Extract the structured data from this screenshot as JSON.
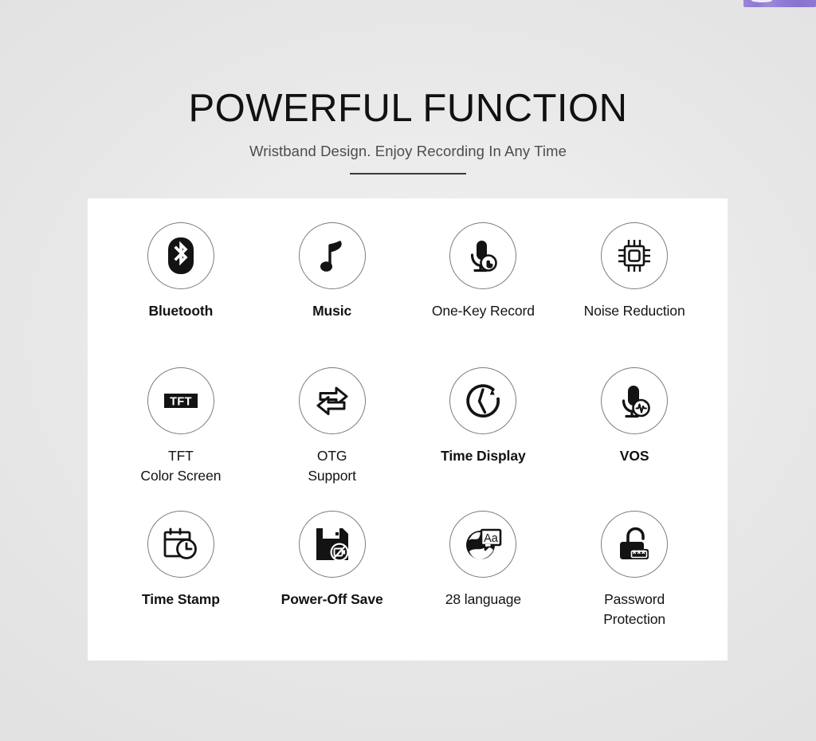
{
  "header": {
    "title": "POWERFUL FUNCTION",
    "subtitle": "Wristband Design. Enjoy Recording In Any Time"
  },
  "theme": {
    "background": "#e6e6e6",
    "panel_background": "#ffffff",
    "text_color": "#111111",
    "subtitle_color": "#4d4d4d",
    "icon_stroke": "#131313",
    "circle_border": "#7d7d7d",
    "accent_sliver": "#8d79d2"
  },
  "features": [
    {
      "label": "Bluetooth",
      "icon": "bluetooth-icon",
      "bold": true
    },
    {
      "label": "Music",
      "icon": "music-note-icon",
      "bold": true
    },
    {
      "label": "One-Key Record",
      "icon": "mic-touch-icon",
      "bold": false
    },
    {
      "label": "Noise Reduction",
      "icon": "cpu-chip-icon",
      "bold": false
    },
    {
      "label": "TFT\nColor Screen",
      "icon": "tft-screen-icon",
      "bold": false
    },
    {
      "label": "OTG\nSupport",
      "icon": "otg-arrows-icon",
      "bold": false
    },
    {
      "label": "Time Display",
      "icon": "clock-refresh-icon",
      "bold": true
    },
    {
      "label": "VOS",
      "icon": "mic-waveform-icon",
      "bold": true
    },
    {
      "label": "Time Stamp",
      "icon": "calendar-clock-icon",
      "bold": true
    },
    {
      "label": "Power-Off Save",
      "icon": "floppy-disk-icon",
      "bold": true
    },
    {
      "label": "28 language",
      "icon": "globe-language-icon",
      "bold": false
    },
    {
      "label": "Password\nProtection",
      "icon": "padlock-open-icon",
      "bold": false
    }
  ]
}
